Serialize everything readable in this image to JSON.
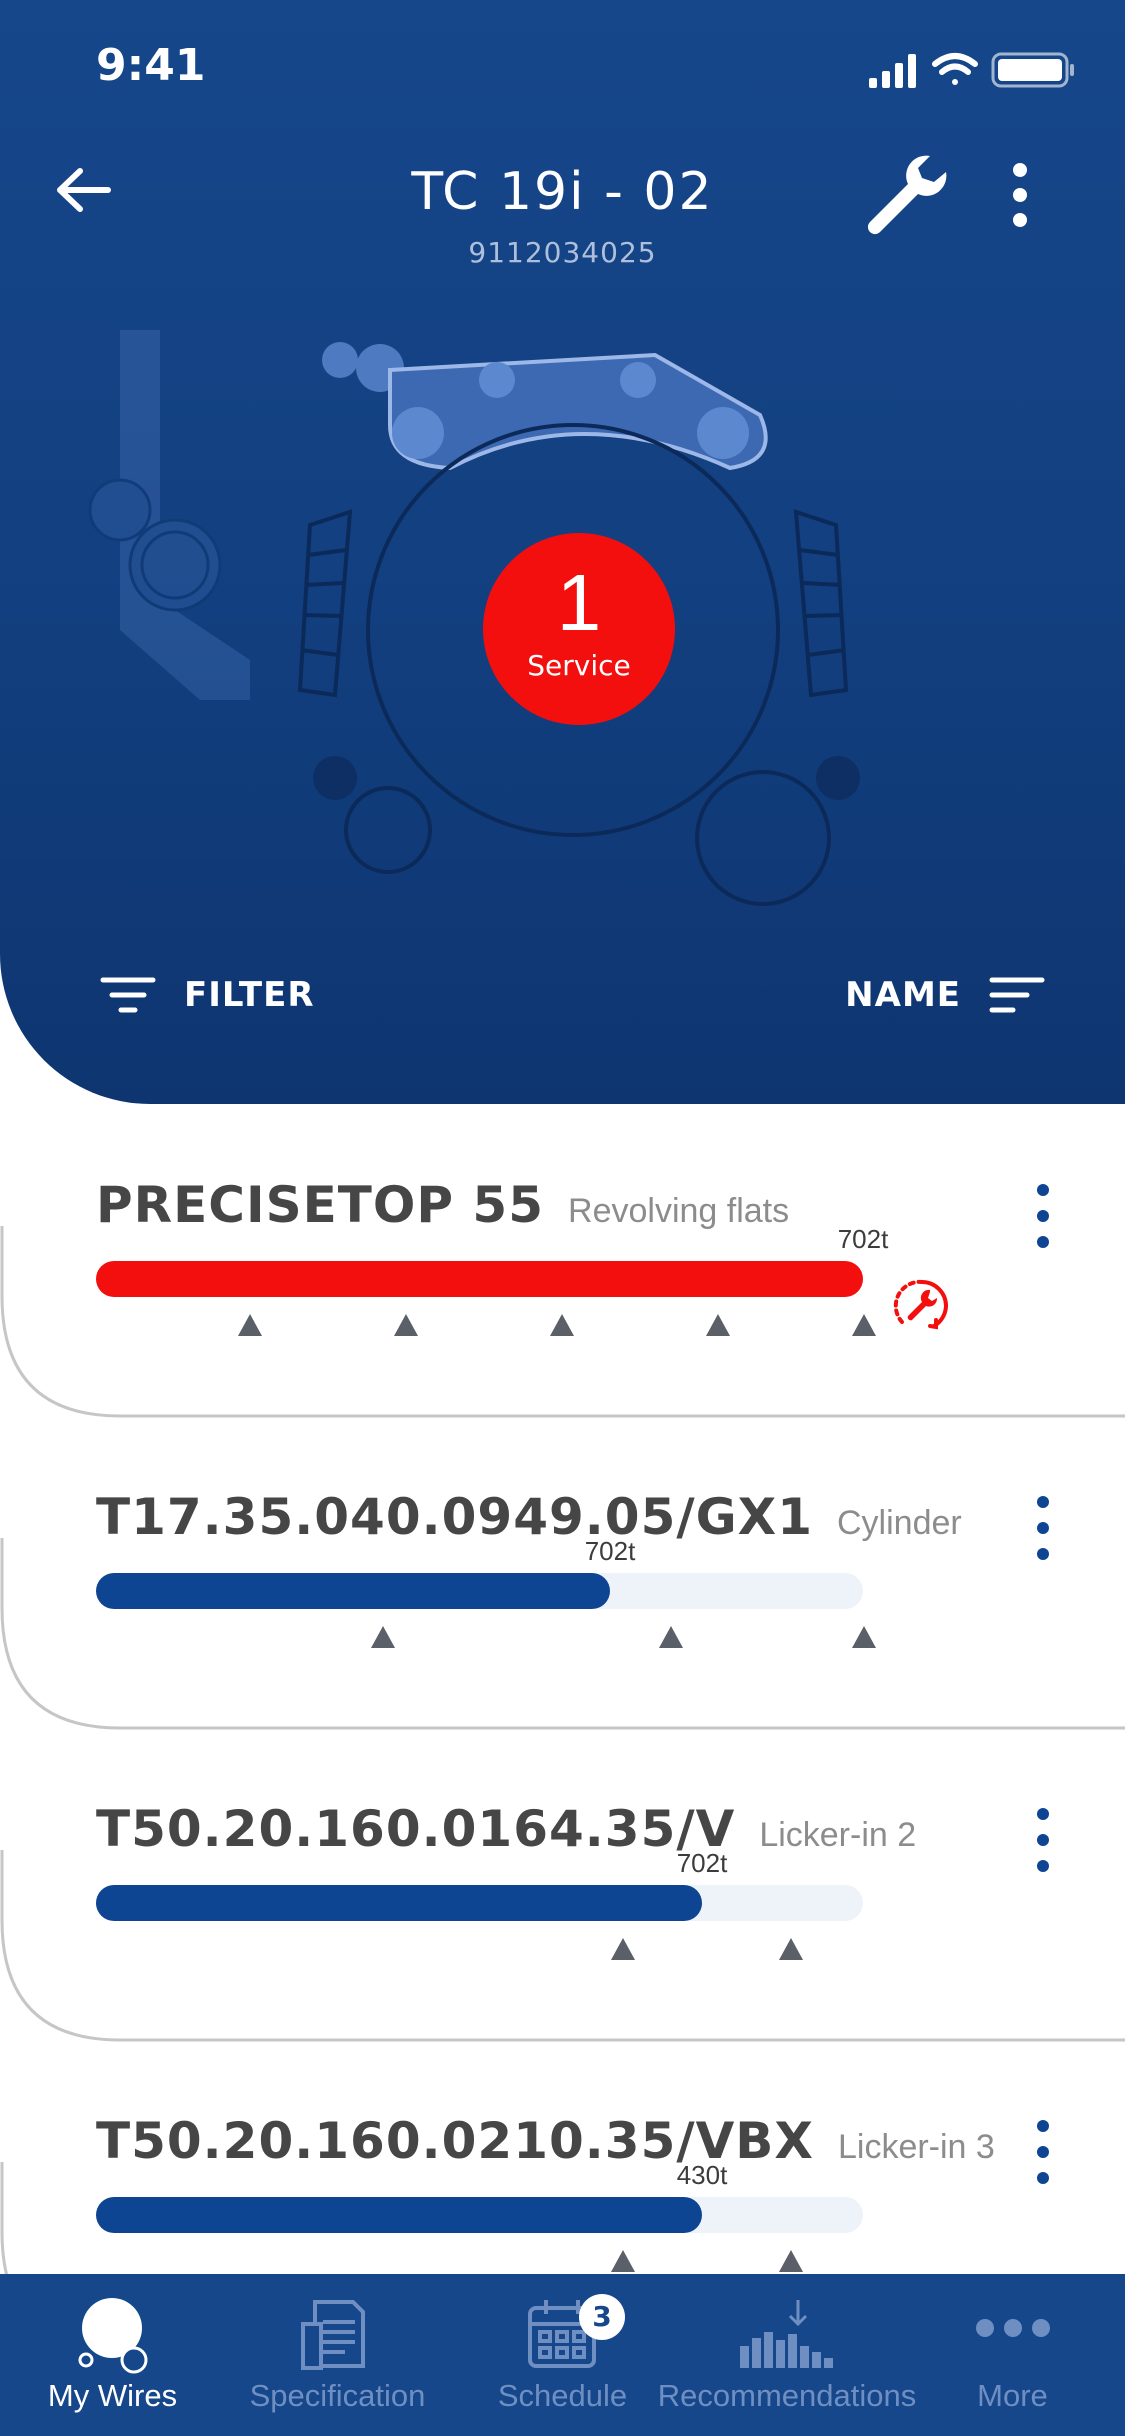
{
  "status_bar": {
    "time": "9:41"
  },
  "header": {
    "title": "TC 19i - 02",
    "subtitle": "9112034025",
    "back_icon": "arrow-left-icon",
    "wrench_icon": "wrench-icon",
    "menu_icon": "kebab-icon"
  },
  "service_badge": {
    "count": "1",
    "label": "Service",
    "color": "#f40f0f"
  },
  "toolbar": {
    "filter_label": "FILTER",
    "sort_label": "NAME"
  },
  "colors": {
    "header_bg": "#16478b",
    "alert_red": "#f40f0f",
    "bar_blue": "#0e4592",
    "track": "#eef3fa"
  },
  "wires": [
    {
      "name": "PRECISETOP 55",
      "type": "Revolving flats",
      "value_label": "702t",
      "fill_fraction": 1.0,
      "status": "alert"
    },
    {
      "name": "T17.35.040.0949.05/GX1",
      "type": "Cylinder",
      "value_label": "702t",
      "fill_fraction": 0.67,
      "status": "ok"
    },
    {
      "name": "T50.20.160.0164.35/V",
      "type": "Licker-in 2",
      "value_label": "702t",
      "fill_fraction": 0.79,
      "status": "ok"
    },
    {
      "name": "T50.20.160.0210.35/VBX",
      "type": "Licker-in 3",
      "value_label": "430t",
      "fill_fraction": 0.79,
      "status": "ok"
    }
  ],
  "bottom_nav": [
    {
      "label": "My Wires",
      "icon": "wires-icon",
      "active": true
    },
    {
      "label": "Specification",
      "icon": "document-icon",
      "active": false
    },
    {
      "label": "Schedule",
      "icon": "calendar-icon",
      "active": false,
      "badge": "3"
    },
    {
      "label": "Recommendations",
      "icon": "bar-chart-icon",
      "active": false
    },
    {
      "label": "More",
      "icon": "more-dots-icon",
      "active": false
    }
  ]
}
